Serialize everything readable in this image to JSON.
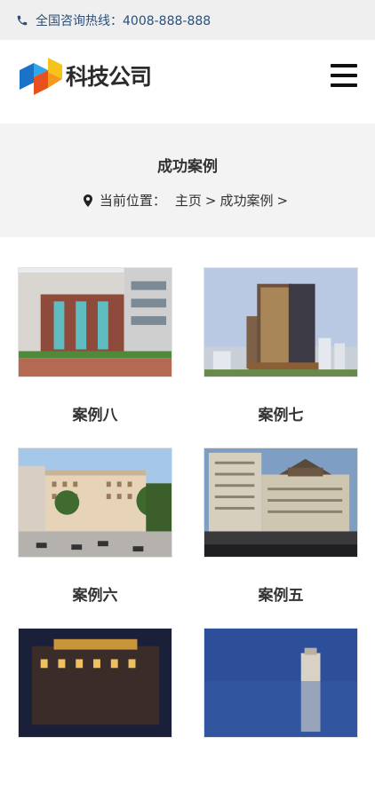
{
  "topbar": {
    "hotline": "全国咨询热线：4008-888-888"
  },
  "header": {
    "logo_text": "科技公司"
  },
  "banner": {
    "title": "成功案例",
    "location_label": "当前位置：",
    "home_link": "主页",
    "current_link": "成功案例",
    "separator": ">"
  },
  "cases": [
    {
      "title": "案例八"
    },
    {
      "title": "案例七"
    },
    {
      "title": "案例六"
    },
    {
      "title": "案例五"
    },
    {
      "title": ""
    },
    {
      "title": ""
    }
  ],
  "colors": {
    "hotline": "#2a4f7a",
    "banner_bg": "#f3f3f3",
    "topbar_bg": "#efefef"
  }
}
